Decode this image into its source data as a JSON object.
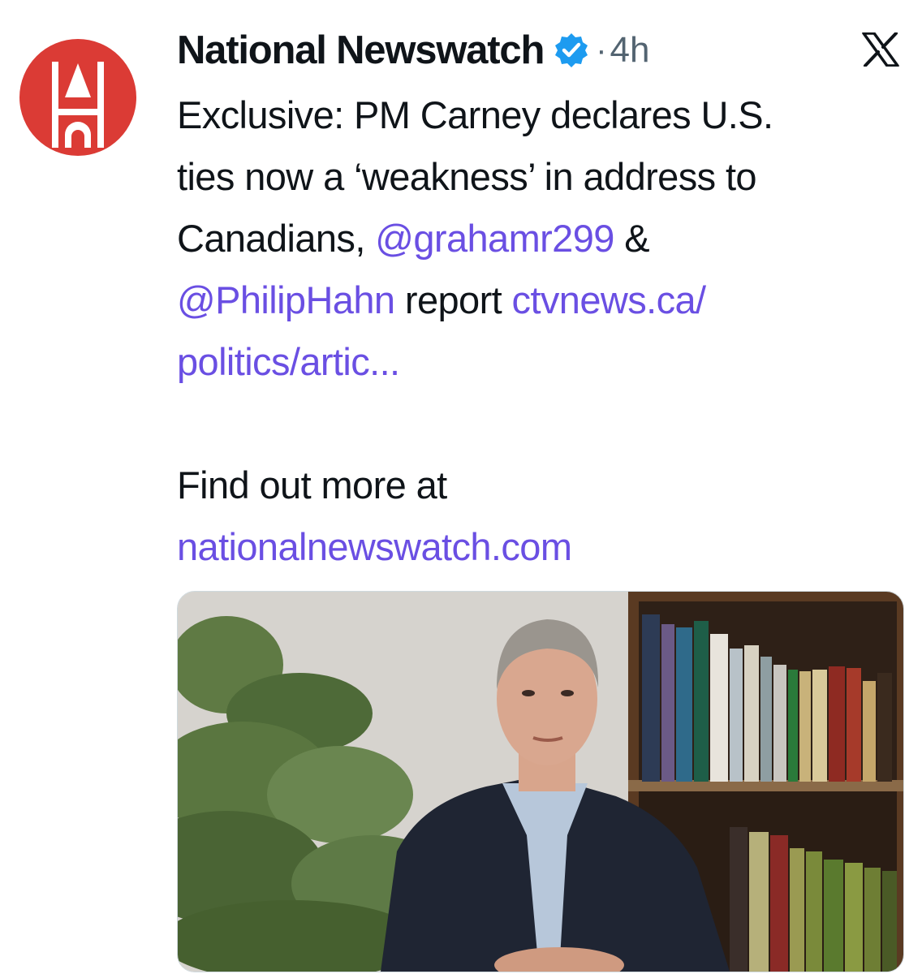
{
  "account": {
    "name": "National Newswatch",
    "verified_icon": "verified-badge-icon",
    "separator": "·",
    "time": "4h",
    "accent_color": "#db3b35",
    "verified_color": "#1d9bf0"
  },
  "platform_icon": "x-logo-icon",
  "tweet": {
    "line1": "Exclusive: PM Carney declares U.S.",
    "line2": "ties now a ‘weakness’ in address to",
    "line3_text": "Canadians, ",
    "mention1": "@grahamr299",
    "line3_tail": " &",
    "mention2": "@PhilipHahn",
    "line4_mid": " report ",
    "link_part1": "ctvnews.ca/",
    "link_part2": "politics/artic...",
    "line6": "Find out more at",
    "site_link": "nationalnewswatch.com",
    "link_color": "#6a4fe3"
  },
  "media": {
    "type": "video-thumbnail",
    "description_icon": "news-photo"
  }
}
